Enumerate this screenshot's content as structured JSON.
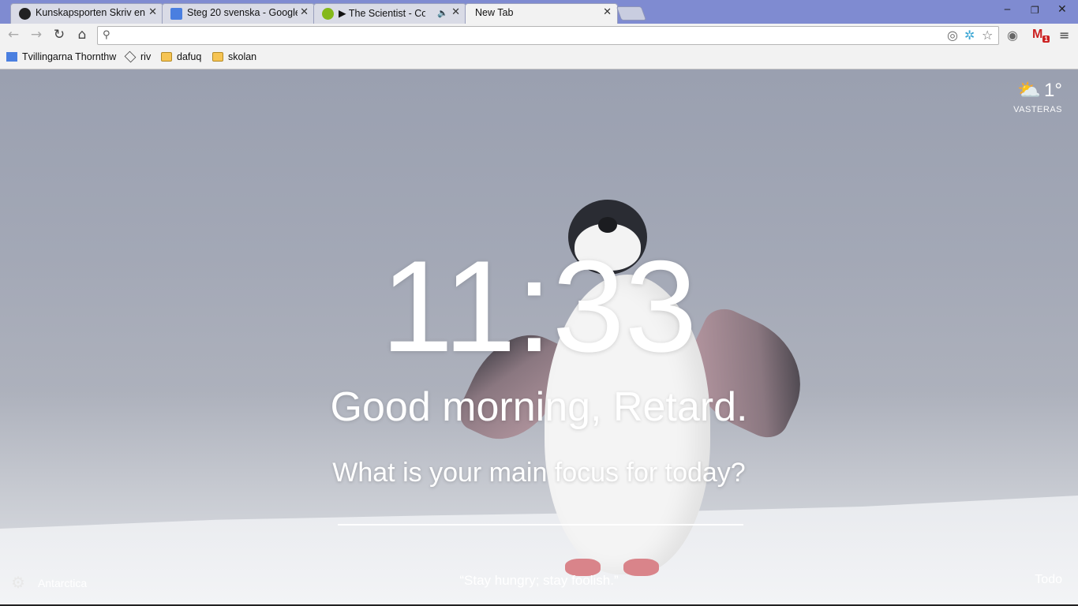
{
  "tabs": [
    {
      "title": "Kunskapsporten Skriv en",
      "icon": "github-icon",
      "color": "#222222"
    },
    {
      "title": "Steg 20 svenska - Google",
      "icon": "docs-icon",
      "color": "#4a7fe0"
    },
    {
      "title": "▶ The Scientist - Cold",
      "icon": "spotify-icon",
      "color": "#84b819"
    },
    {
      "title": "New Tab",
      "icon": "",
      "color": ""
    }
  ],
  "toolbar": {
    "omnibox_value": ""
  },
  "bookmarks": [
    {
      "label": "Tvillingarna Thornthw",
      "icon": "google-icon"
    },
    {
      "label": "riv",
      "icon": "cube-icon"
    },
    {
      "label": "dafuq",
      "icon": "folder-icon"
    },
    {
      "label": "skolan",
      "icon": "folder-icon"
    }
  ],
  "gmail_badge": "1",
  "weather": {
    "temp": "1°",
    "location": "VASTERAS"
  },
  "clock": "11:33",
  "greeting": "Good morning, Retard.",
  "focus_question": "What is your main focus for today?",
  "focus_value": "",
  "footer": {
    "location": "Antarctica",
    "quote": "“Stay hungry; stay foolish.”",
    "todo": "Todo"
  }
}
